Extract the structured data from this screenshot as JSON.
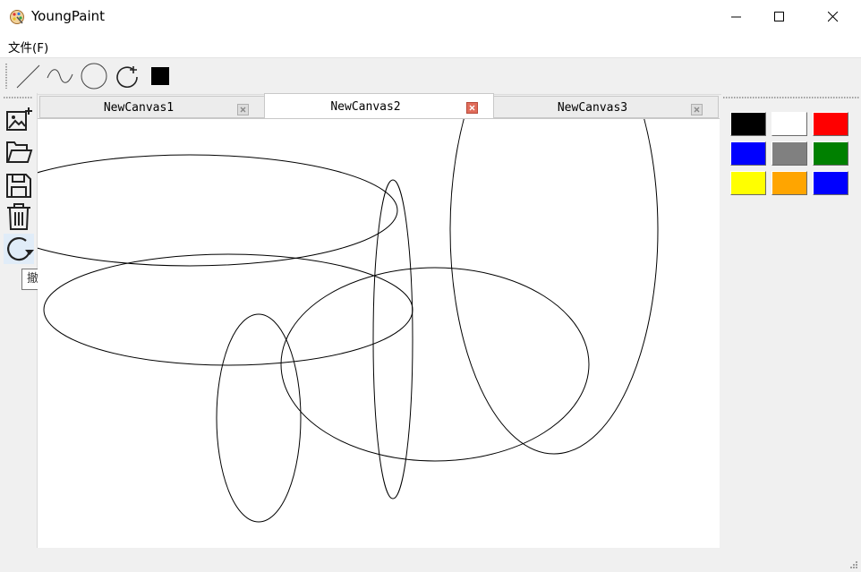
{
  "window": {
    "title": "YoungPaint",
    "controls": [
      "minimize",
      "maximize",
      "close"
    ]
  },
  "menu": {
    "items": [
      {
        "label": "文件(F)"
      }
    ]
  },
  "toolbar": {
    "tools": [
      {
        "name": "line",
        "icon": "line-icon"
      },
      {
        "name": "curve",
        "icon": "curve-icon"
      },
      {
        "name": "ellipse",
        "icon": "ellipse-icon"
      },
      {
        "name": "rotate",
        "icon": "rotate-icon"
      },
      {
        "name": "color",
        "icon": "color-square-icon",
        "color": "#000000"
      }
    ]
  },
  "left_toolbar": {
    "tools": [
      {
        "name": "new-image",
        "icon": "add-image-icon"
      },
      {
        "name": "open",
        "icon": "folder-icon"
      },
      {
        "name": "save",
        "icon": "save-icon"
      },
      {
        "name": "delete",
        "icon": "trash-icon"
      },
      {
        "name": "undo",
        "icon": "undo-icon",
        "active": true
      }
    ],
    "tooltip": "撤销"
  },
  "tabs": [
    {
      "label": "NewCanvas1",
      "active": false
    },
    {
      "label": "NewCanvas2",
      "active": true
    },
    {
      "label": "NewCanvas3",
      "active": false
    }
  ],
  "palette": {
    "colors": [
      "#000000",
      "#ffffff",
      "#ff0000",
      "#0000ff",
      "#808080",
      "#008000",
      "#ffff00",
      "#ffa500",
      "#0000ff"
    ]
  },
  "colors": {
    "close_active": "#e06c5a",
    "canvas_bg": "#ffffff",
    "stroke": "#000000"
  }
}
